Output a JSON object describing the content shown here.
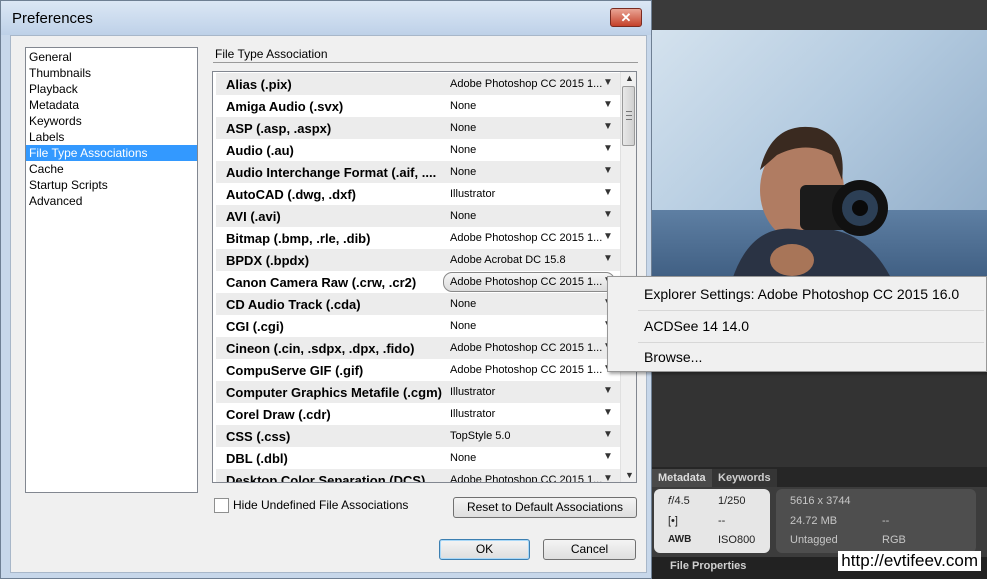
{
  "window": {
    "title": "Preferences",
    "close_label": "✕"
  },
  "categories": [
    {
      "label": "General",
      "selected": false
    },
    {
      "label": "Thumbnails",
      "selected": false
    },
    {
      "label": "Playback",
      "selected": false
    },
    {
      "label": "Metadata",
      "selected": false
    },
    {
      "label": "Keywords",
      "selected": false
    },
    {
      "label": "Labels",
      "selected": false
    },
    {
      "label": "File Type Associations",
      "selected": true
    },
    {
      "label": "Cache",
      "selected": false
    },
    {
      "label": "Startup Scripts",
      "selected": false
    },
    {
      "label": "Advanced",
      "selected": false
    }
  ],
  "section_title": "File Type Association",
  "associations": [
    {
      "name": "Alias (.pix)",
      "app": "Adobe Photoshop CC 2015 1..."
    },
    {
      "name": "Amiga Audio (.svx)",
      "app": "None"
    },
    {
      "name": "ASP (.asp, .aspx)",
      "app": "None"
    },
    {
      "name": "Audio (.au)",
      "app": "None"
    },
    {
      "name": "Audio Interchange Format (.aif, ....",
      "app": "None"
    },
    {
      "name": "AutoCAD (.dwg, .dxf)",
      "app": "Illustrator"
    },
    {
      "name": "AVI (.avi)",
      "app": "None"
    },
    {
      "name": "Bitmap (.bmp, .rle, .dib)",
      "app": "Adobe Photoshop CC 2015 1..."
    },
    {
      "name": "BPDX (.bpdx)",
      "app": "Adobe Acrobat DC 15.8"
    },
    {
      "name": "Canon Camera Raw (.crw, .cr2)",
      "app": "Adobe Photoshop CC 2015 1..."
    },
    {
      "name": "CD Audio Track (.cda)",
      "app": "None"
    },
    {
      "name": "CGI (.cgi)",
      "app": "None"
    },
    {
      "name": "Cineon (.cin, .sdpx, .dpx, .fido)",
      "app": "Adobe Photoshop CC 2015 1..."
    },
    {
      "name": "CompuServe GIF (.gif)",
      "app": "Adobe Photoshop CC 2015 1..."
    },
    {
      "name": "Computer Graphics Metafile (.cgm)",
      "app": "Illustrator"
    },
    {
      "name": "Corel Draw (.cdr)",
      "app": "Illustrator"
    },
    {
      "name": "CSS (.css)",
      "app": "TopStyle 5.0"
    },
    {
      "name": "DBL (.dbl)",
      "app": "None"
    },
    {
      "name": "Desktop Color Separation (DCS)",
      "app": "Adobe Photoshop CC 2015 1..."
    }
  ],
  "open_row_index": 9,
  "popup_menu": [
    "Explorer Settings: Adobe Photoshop CC 2015 16.0",
    "ACDSee 14 14.0",
    "Browse..."
  ],
  "hide_undefined_label": "Hide Undefined File Associations",
  "hide_undefined_checked": false,
  "reset_label": "Reset to Default Associations",
  "ok_label": "OK",
  "cancel_label": "Cancel",
  "background_app": {
    "tabs": [
      "Metadata",
      "Keywords"
    ],
    "aperture": "𝑓/4.5",
    "shutter": "1/250",
    "metering": "--",
    "wb": "AWB",
    "iso": "ISO800",
    "dimensions": "5616 x 3744",
    "filesize": "24.72 MB",
    "dash2": "--",
    "tag": "Untagged",
    "colormode": "RGB",
    "panel_title": "File Properties"
  },
  "watermark": "http://evtifeev.com"
}
